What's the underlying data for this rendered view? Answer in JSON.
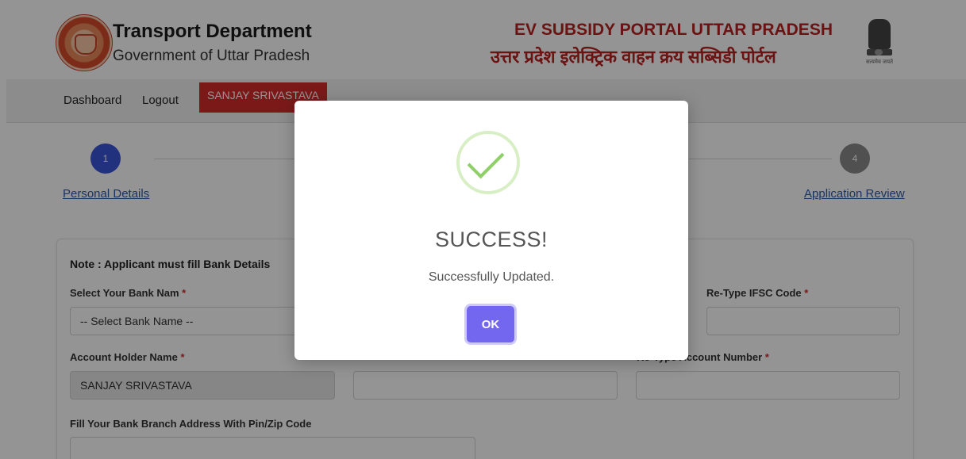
{
  "header": {
    "dept_title": "Transport Department",
    "dept_subtitle": "Government of Uttar Pradesh",
    "portal_title_en": "EV SUBSIDY PORTAL UTTAR PRADESH",
    "portal_title_hi": "उत्तर प्रदेश इलेक्ट्रिक वाहन क्रय सब्सिडी पोर्टल",
    "emblem_caption": "सत्यमेव जयते"
  },
  "nav": {
    "dashboard": "Dashboard",
    "logout": "Logout",
    "user": "SANJAY SRIVASTAVA"
  },
  "stepper": {
    "step1_num": "1",
    "step1_label": "Personal Details",
    "step4_num": "4",
    "step4_label": "Application Review"
  },
  "form": {
    "note": "Note : Applicant must fill Bank Details",
    "bank_label": "Select Your Bank Nam",
    "bank_value": "-- Select Bank Name --",
    "retype_ifsc_label": "Re-Type IFSC Code",
    "holder_label": "Account Holder Name",
    "holder_value": "SANJAY SRIVASTAVA",
    "retype_account_label": "Re-Type Account Number",
    "address_label": "Fill Your Bank Branch Address With Pin/Zip Code",
    "required_mark": "*"
  },
  "modal": {
    "title": "SUCCESS!",
    "message": "Successfully Updated.",
    "ok_label": "OK"
  },
  "colors": {
    "brand_red": "#b8211f",
    "nav_user_bg": "#d52b2b",
    "step_active": "#3b55d9",
    "step_inactive": "#8a8a8a",
    "ok_button": "#7367f0",
    "success_check": "#8ecf69"
  }
}
